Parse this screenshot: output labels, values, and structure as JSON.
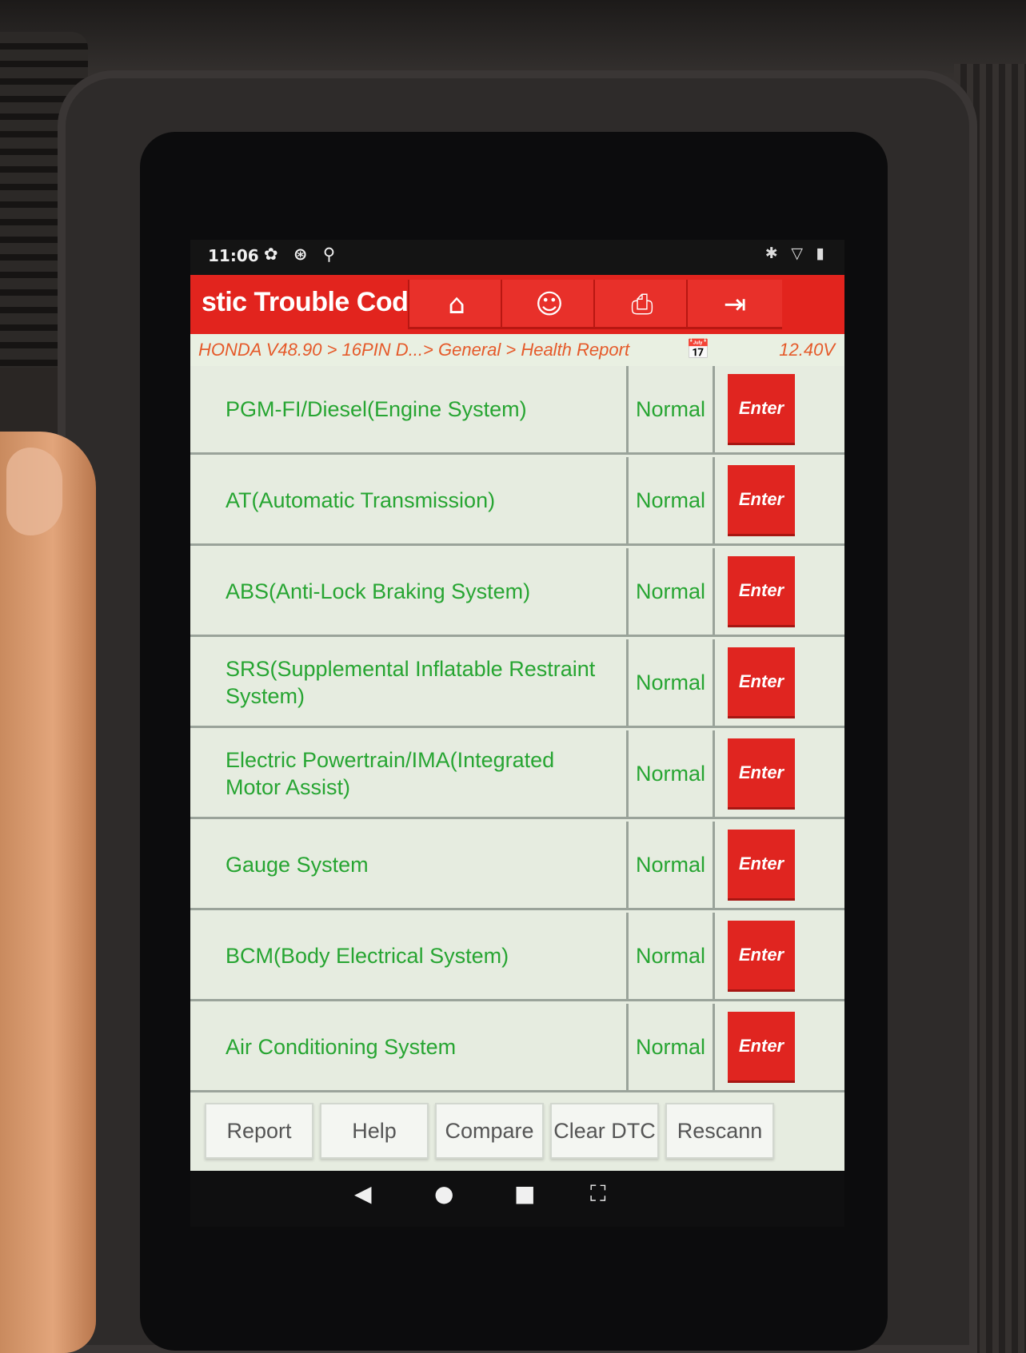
{
  "status_bar": {
    "time": "11:06",
    "left_icons": "✿ ⊛ ⚲",
    "right_icons": "✱ ▽ ▮"
  },
  "title_bar": {
    "title": "stic Trouble Code",
    "buttons": [
      {
        "name": "home-icon",
        "glyph": "⌂"
      },
      {
        "name": "support-icon",
        "glyph": "☺"
      },
      {
        "name": "print-icon",
        "glyph": "⎙"
      },
      {
        "name": "exit-icon",
        "glyph": "⇥"
      }
    ]
  },
  "breadcrumb": {
    "path": "HONDA V48.90 > 16PIN D...> General > Health Report",
    "calendar_icon": "📅",
    "voltage": "12.40V"
  },
  "systems": [
    {
      "name": "PGM-FI/Diesel(Engine System)",
      "status": "Normal",
      "action": "Enter"
    },
    {
      "name": "AT(Automatic Transmission)",
      "status": "Normal",
      "action": "Enter"
    },
    {
      "name": "ABS(Anti-Lock Braking System)",
      "status": "Normal",
      "action": "Enter"
    },
    {
      "name": "SRS(Supplemental Inflatable Restraint System)",
      "status": "Normal",
      "action": "Enter"
    },
    {
      "name": "Electric Powertrain/IMA(Integrated Motor Assist)",
      "status": "Normal",
      "action": "Enter"
    },
    {
      "name": "Gauge System",
      "status": "Normal",
      "action": "Enter"
    },
    {
      "name": "BCM(Body Electrical System)",
      "status": "Normal",
      "action": "Enter"
    },
    {
      "name": "Air Conditioning System",
      "status": "Normal",
      "action": "Enter"
    }
  ],
  "actions": {
    "report": "Report",
    "help": "Help",
    "compare": "Compare",
    "clear_dtc": "Clear DTC",
    "rescan": "Rescann"
  },
  "nav_bar": {
    "back": "◀",
    "home": "●",
    "recents": "■",
    "screenshot": "⛶"
  },
  "colors": {
    "accent_red": "#e2241e",
    "status_green": "#27a532",
    "breadcrumb_orange": "#e55a2a",
    "list_bg": "#e6ece0"
  }
}
